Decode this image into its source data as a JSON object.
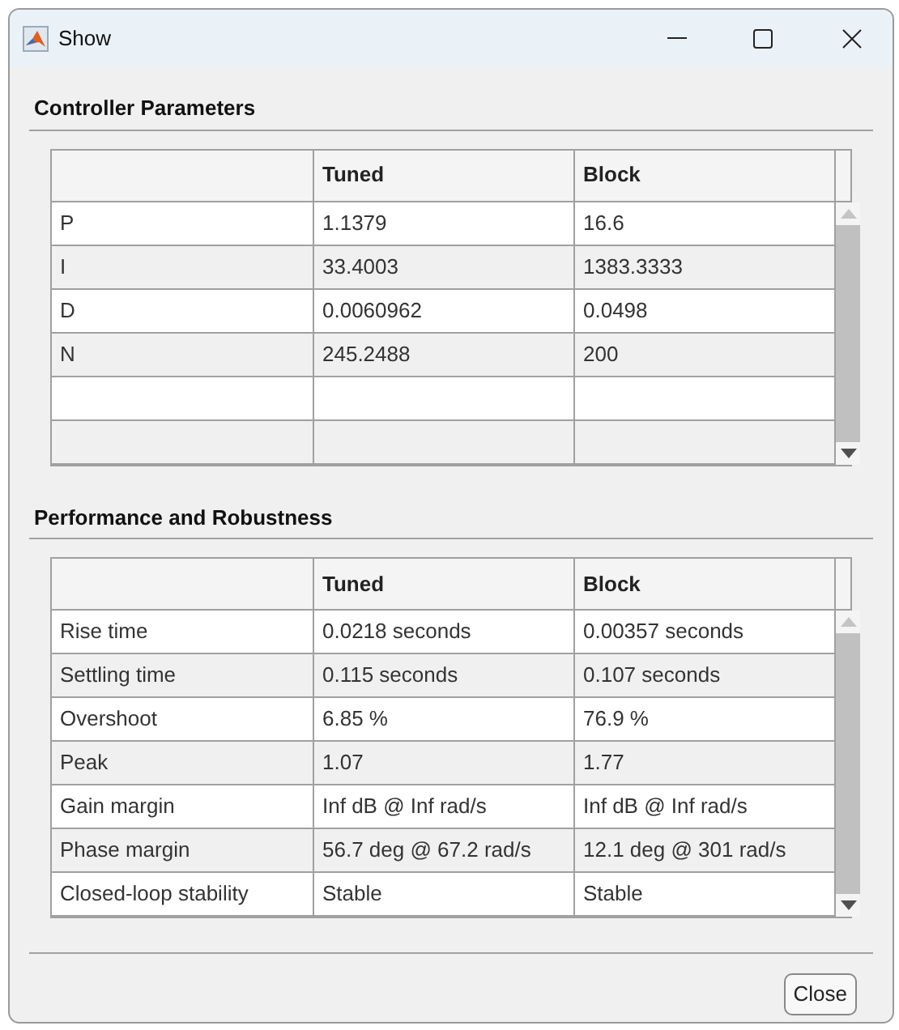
{
  "window": {
    "title": "Show"
  },
  "sections": [
    {
      "title": "Controller Parameters",
      "columns": [
        "Tuned",
        "Block"
      ],
      "rows": [
        {
          "label": "P",
          "values": [
            "1.1379",
            "16.6"
          ]
        },
        {
          "label": "I",
          "values": [
            "33.4003",
            "1383.3333"
          ]
        },
        {
          "label": "D",
          "values": [
            "0.0060962",
            "0.0498"
          ]
        },
        {
          "label": "N",
          "values": [
            "245.2488",
            "200"
          ]
        },
        {
          "kind": "empty"
        },
        {
          "kind": "empty"
        }
      ]
    },
    {
      "title": "Performance and Robustness",
      "columns": [
        "Tuned",
        "Block"
      ],
      "rows": [
        {
          "label": "Rise time",
          "values": [
            "0.0218 seconds",
            "0.00357 seconds"
          ]
        },
        {
          "label": "Settling time",
          "values": [
            "0.115 seconds",
            "0.107 seconds"
          ]
        },
        {
          "label": "Overshoot",
          "values": [
            "6.85 %",
            "76.9 %"
          ]
        },
        {
          "label": "Peak",
          "values": [
            "1.07",
            "1.77"
          ]
        },
        {
          "label": "Gain margin",
          "values": [
            "Inf dB @ Inf rad/s",
            "Inf dB @ Inf rad/s"
          ]
        },
        {
          "label": "Phase margin",
          "values": [
            "56.7 deg @ 67.2 rad/s",
            "12.1 deg @ 301 rad/s"
          ]
        },
        {
          "label": "Closed-loop stability",
          "values": [
            "Stable",
            "Stable"
          ]
        }
      ]
    }
  ],
  "buttons": [
    "Close"
  ]
}
